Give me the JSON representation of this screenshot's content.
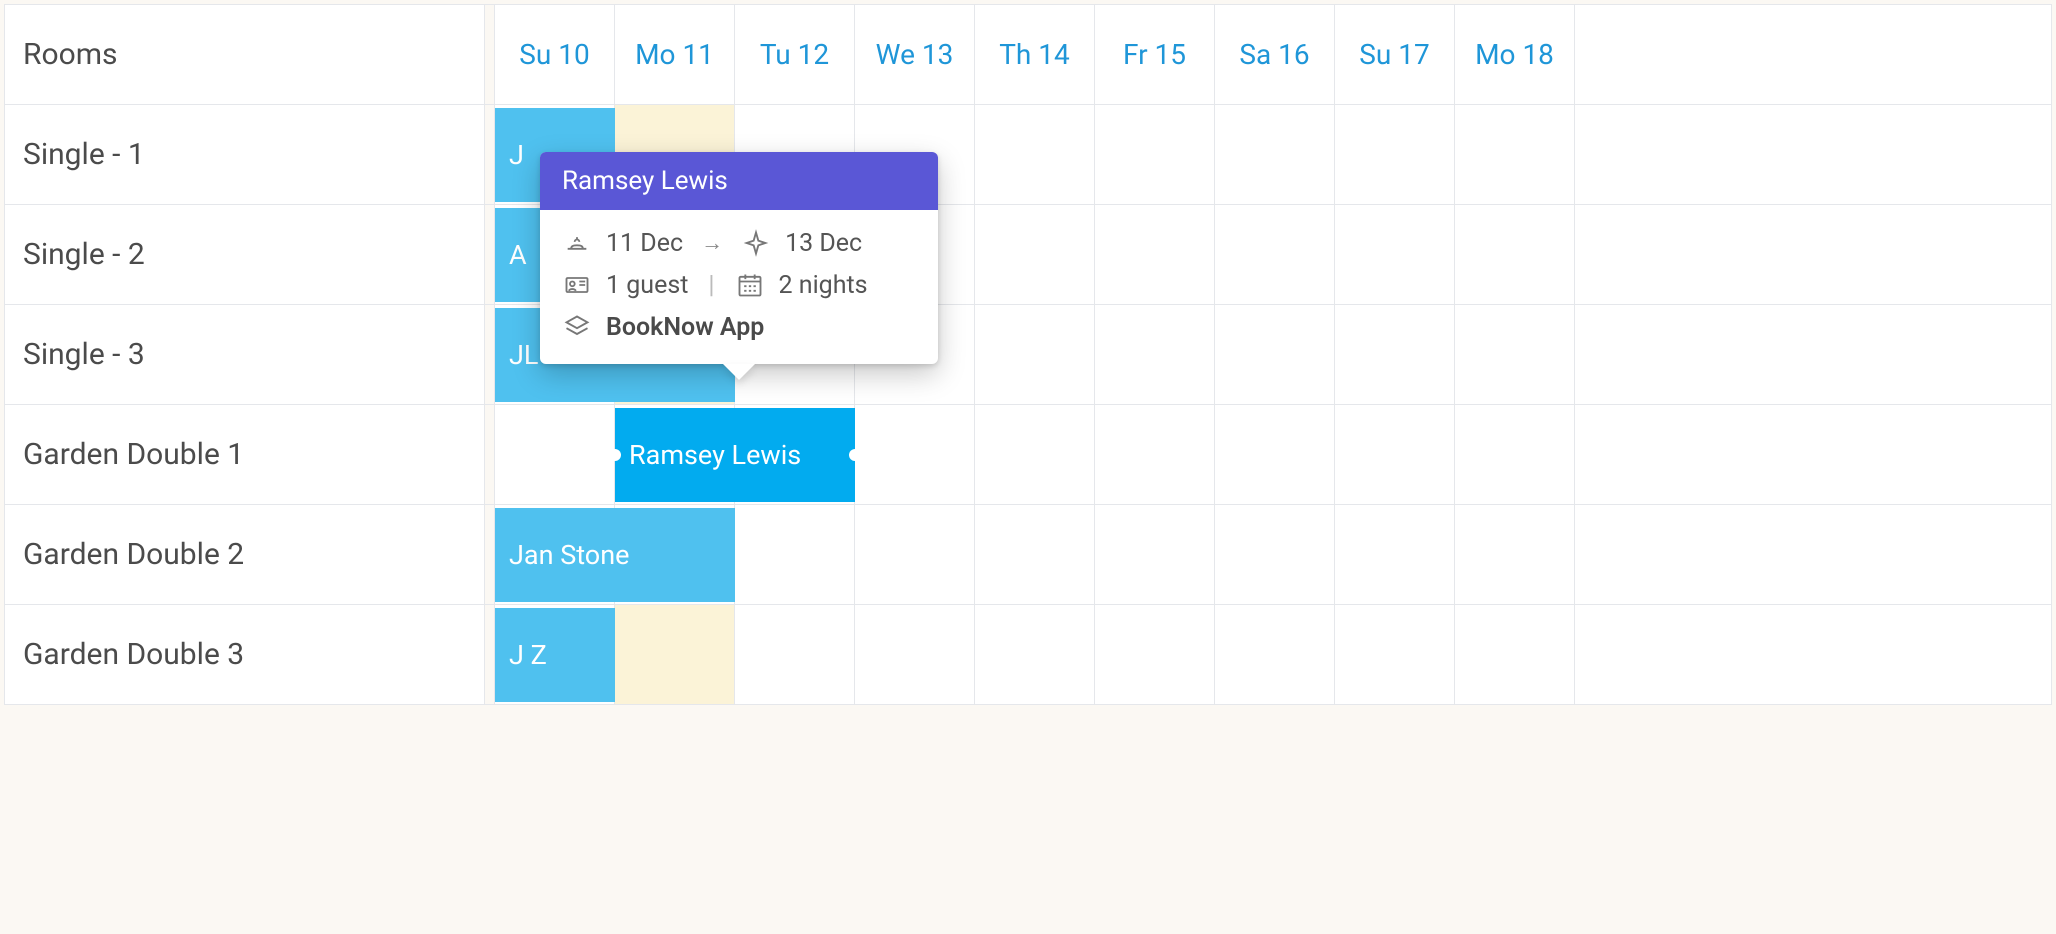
{
  "header": {
    "rooms_label": "Rooms",
    "days": [
      "Su 10",
      "Mo 11",
      "Tu 12",
      "We 13",
      "Th 14",
      "Fr 15",
      "Sa 16",
      "Su 17",
      "Mo 18"
    ]
  },
  "rooms": [
    {
      "name": "Single - 1",
      "highlight_cols": [
        1
      ]
    },
    {
      "name": "Single - 2",
      "highlight_cols": [
        1
      ]
    },
    {
      "name": "Single - 3",
      "highlight_cols": [
        1
      ]
    },
    {
      "name": "Garden Double 1",
      "highlight_cols": []
    },
    {
      "name": "Garden Double 2",
      "highlight_cols": []
    },
    {
      "name": "Garden Double 3",
      "highlight_cols": [
        1
      ]
    }
  ],
  "bookings": [
    {
      "room_index": 0,
      "start_col": 0,
      "span": 1,
      "label": "J",
      "variant": "blue",
      "truncated": true,
      "selected": false
    },
    {
      "room_index": 1,
      "start_col": 0,
      "span": 1,
      "label": "A",
      "variant": "blue",
      "truncated": true,
      "selected": false
    },
    {
      "room_index": 2,
      "start_col": 0,
      "span": 2,
      "label": "JL",
      "variant": "blue",
      "truncated": true,
      "selected": false
    },
    {
      "room_index": 3,
      "start_col": 1,
      "span": 2,
      "label": "Ramsey Lewis",
      "variant": "sel",
      "truncated": false,
      "selected": true
    },
    {
      "room_index": 4,
      "start_col": 0,
      "span": 2,
      "label": "Jan Stone",
      "variant": "blue",
      "truncated": false,
      "selected": false
    },
    {
      "room_index": 5,
      "start_col": 0,
      "span": 1,
      "label": "J Z",
      "variant": "blue",
      "truncated": false,
      "selected": false
    }
  ],
  "popover": {
    "guest_name": "Ramsey Lewis",
    "checkin": "11 Dec",
    "checkout": "13 Dec",
    "guests": "1 guest",
    "nights": "2 nights",
    "source": "BookNow App"
  }
}
